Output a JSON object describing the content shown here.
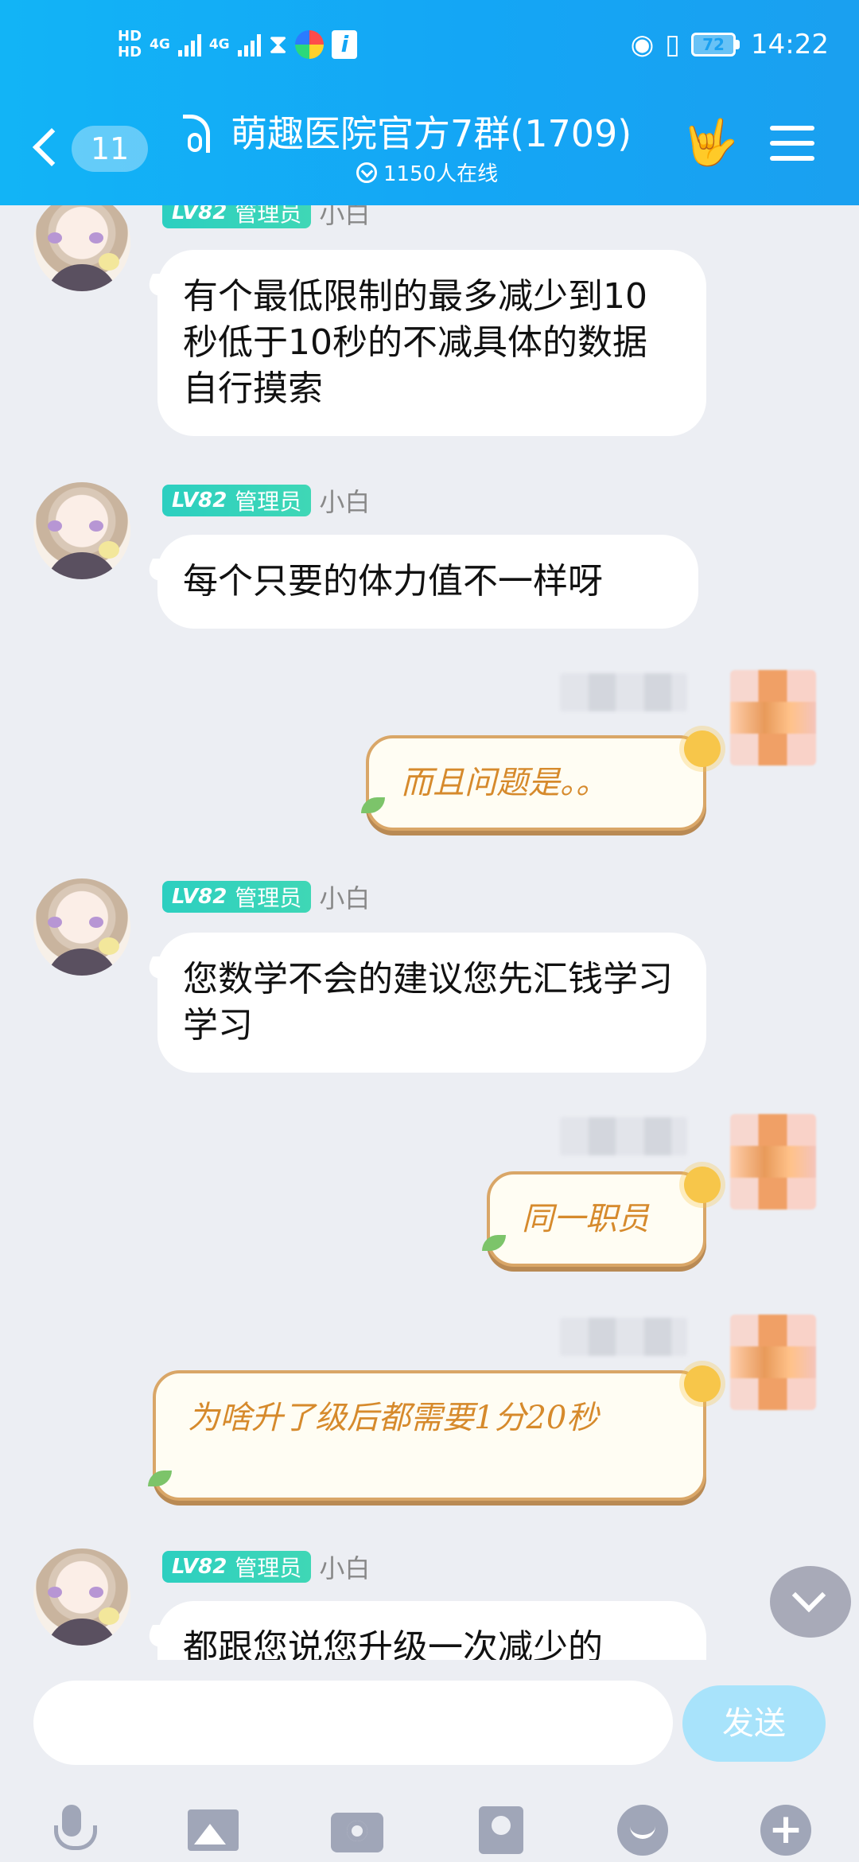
{
  "status_bar": {
    "hd1": "HD",
    "hd2": "HD",
    "net1": "4G",
    "net2": "4G",
    "battery": "72",
    "time": "14:22"
  },
  "header": {
    "unread_count": "11",
    "group_name": "萌趣医院官方7群(1709)",
    "online_text": "1150人在线"
  },
  "messages": [
    {
      "type": "other",
      "badge_level": "LV82",
      "badge_role": "管理员",
      "sender": "小白",
      "text": "有个最低限制的最多减少到10秒低于10秒的不减具体的数据自行摸索"
    },
    {
      "type": "other",
      "badge_level": "LV82",
      "badge_role": "管理员",
      "sender": "小白",
      "text": "每个只要的体力值不一样呀"
    },
    {
      "type": "self",
      "text": "而且问题是。。"
    },
    {
      "type": "other",
      "badge_level": "LV82",
      "badge_role": "管理员",
      "sender": "小白",
      "text": "您数学不会的建议您先汇钱学习学习"
    },
    {
      "type": "self",
      "text": "同一职员"
    },
    {
      "type": "self",
      "text": "为啥升了级后都需要1分20秒"
    },
    {
      "type": "other",
      "badge_level": "LV82",
      "badge_role": "管理员",
      "sender": "小白",
      "text": "都跟您说您升级一次减少的"
    }
  ],
  "input": {
    "placeholder": "",
    "send_label": "发送"
  }
}
